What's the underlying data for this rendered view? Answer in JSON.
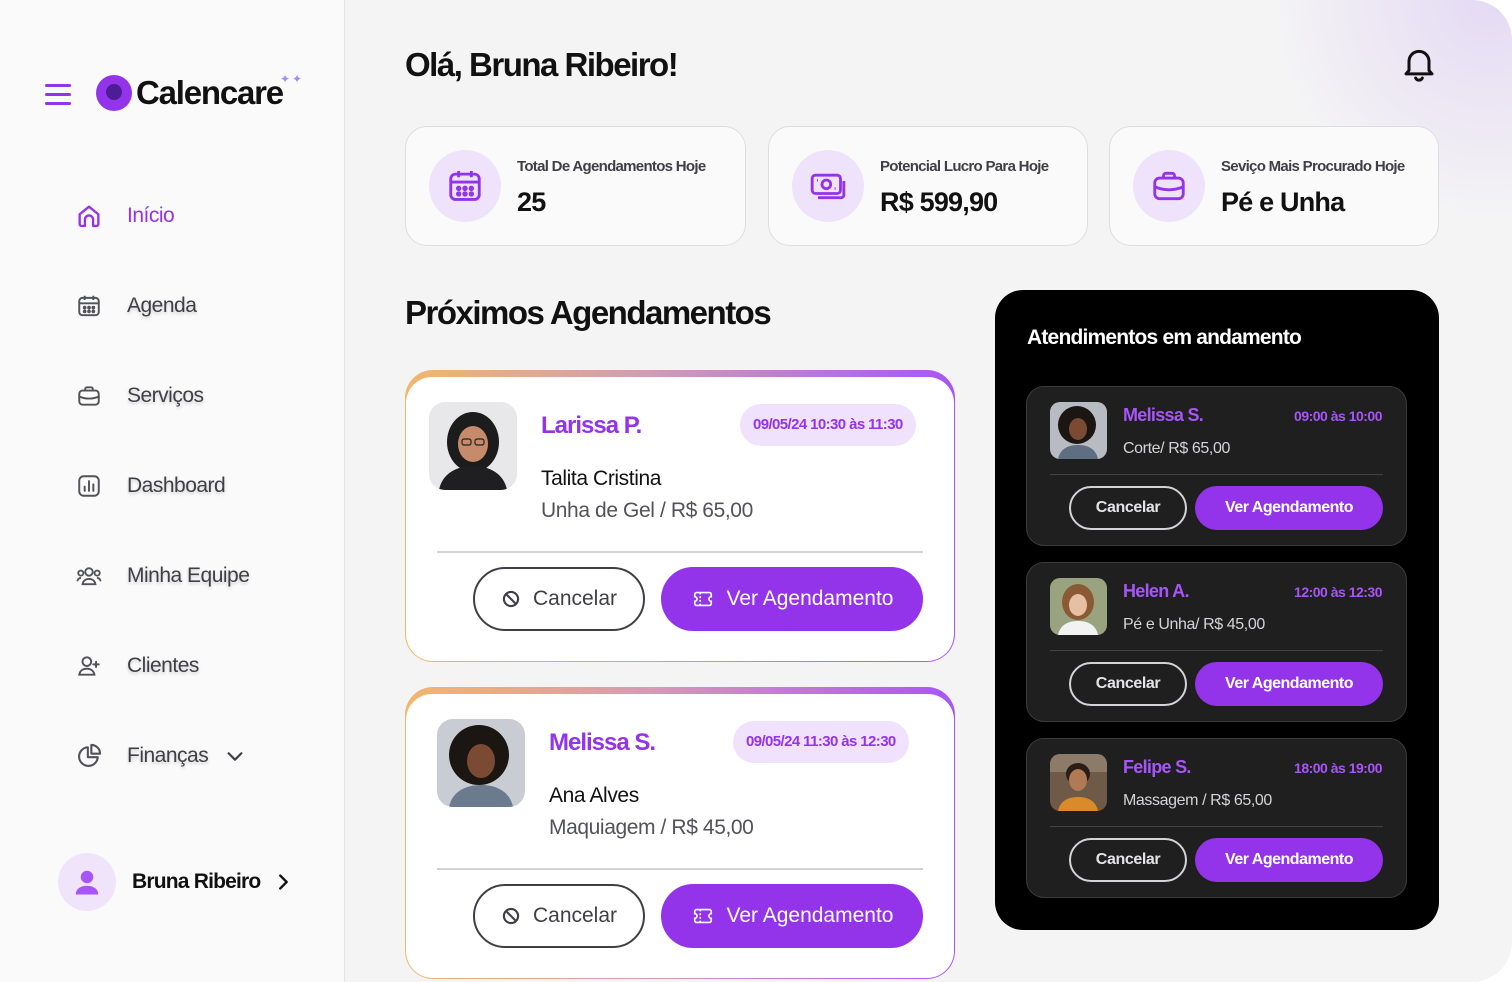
{
  "brand": {
    "name": "Calencare",
    "accent": "#9333ea"
  },
  "sidebar": {
    "items": [
      {
        "label": "Início",
        "icon": "home-icon",
        "active": true
      },
      {
        "label": "Agenda",
        "icon": "calendar-icon"
      },
      {
        "label": "Serviços",
        "icon": "briefcase-icon"
      },
      {
        "label": "Dashboard",
        "icon": "chart-icon"
      },
      {
        "label": "Minha Equipe",
        "icon": "team-icon"
      },
      {
        "label": "Clientes",
        "icon": "add-user-icon"
      },
      {
        "label": "Finanças",
        "icon": "pie-chart-icon"
      }
    ],
    "user": {
      "name": "Bruna Ribeiro"
    }
  },
  "header": {
    "greeting": "Olá, Bruna Ribeiro!"
  },
  "stats": [
    {
      "label": "Total De Agendamentos Hoje",
      "value": "25",
      "icon": "calendar-icon"
    },
    {
      "label": "Potencial Lucro Para Hoje",
      "value": "R$ 599,90",
      "icon": "money-icon"
    },
    {
      "label": "Seviço Mais Procurado Hoje",
      "value": "Pé e Unha",
      "icon": "briefcase-icon"
    }
  ],
  "upcoming": {
    "title": "Próximos Agendamentos",
    "items": [
      {
        "client": "Larissa P.",
        "date": "09/05/24 10:30 às 11:30",
        "professional": "Talita Cristina",
        "service": "Unha de Gel / R$ 65,00",
        "cancel": "Cancelar",
        "view": "Ver Agendamento"
      },
      {
        "client": "Melissa S.",
        "date": "09/05/24 11:30 às 12:30",
        "professional": "Ana Alves",
        "service": "Maquiagem / R$ 45,00",
        "cancel": "Cancelar",
        "view": "Ver Agendamento"
      }
    ]
  },
  "ongoing": {
    "title": "Atendimentos em andamento",
    "items": [
      {
        "name": "Melissa S.",
        "time": "09:00 às 10:00",
        "service": "Corte/ R$ 65,00",
        "cancel": "Cancelar",
        "view": "Ver Agendamento"
      },
      {
        "name": "Helen A.",
        "time": "12:00 às 12:30",
        "service": "Pé e Unha/ R$ 45,00",
        "cancel": "Cancelar",
        "view": "Ver Agendamento"
      },
      {
        "name": "Felipe S.",
        "time": "18:00 às 19:00",
        "service": "Massagem / R$ 65,00",
        "cancel": "Cancelar",
        "view": "Ver Agendamento"
      }
    ]
  }
}
